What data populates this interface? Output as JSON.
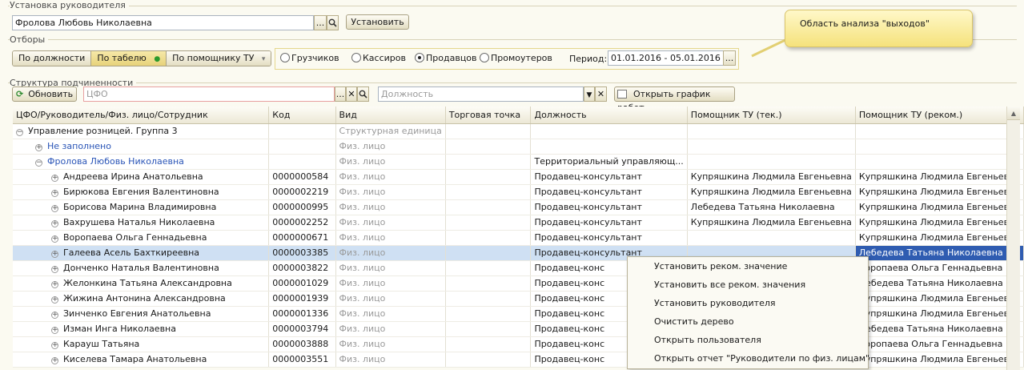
{
  "manager_group": {
    "title": "Установка руководителя",
    "manager_value": "Фролова Любовь Николаевна",
    "choose_label": "...",
    "set_label": "Установить"
  },
  "filters": {
    "title": "Отборы",
    "tabs": [
      {
        "label": "По должности"
      },
      {
        "label": "По табелю"
      },
      {
        "label": "По помощнику ТУ"
      }
    ],
    "active_tab": "По табелю",
    "radios": [
      {
        "label": "Грузчиков"
      },
      {
        "label": "Кассиров"
      },
      {
        "label": "Продавцов"
      },
      {
        "label": "Промоутеров"
      }
    ],
    "selected_radio": "Продавцов",
    "period_label": "Период:",
    "period_value": "01.01.2016 - 05.01.2016",
    "period_choose": "..."
  },
  "callout": {
    "text": "Область анализа \"выходов\""
  },
  "structure": {
    "title": "Структура подчиненности",
    "refresh_label": "Обновить",
    "cfo_placeholder": "ЦФО",
    "position_placeholder": "Должность",
    "open_schedule_label": "Открыть график работ"
  },
  "table": {
    "headers": [
      "ЦФО/Руководитель/Физ. лицо/Сотрудник",
      "Код",
      "Вид",
      "Торговая точка",
      "Должность",
      "Помощник ТУ (тек.)",
      "Помощник ТУ (реком.)"
    ],
    "rows": [
      {
        "name": "Управление розницей. Группа 3",
        "code": "",
        "kind": "Структурная единица",
        "point": "",
        "position": "",
        "cur": "",
        "rec": ""
      },
      {
        "name": "Не заполнено",
        "code": "",
        "kind": "Физ. лицо",
        "point": "",
        "position": "",
        "cur": "",
        "rec": ""
      },
      {
        "name": "Фролова Любовь Николаевна",
        "code": "",
        "kind": "Физ. лицо",
        "point": "",
        "position": "Территориальный управляющ...",
        "cur": "",
        "rec": ""
      },
      {
        "name": "Андреева Ирина Анатольевна",
        "code": "0000000584",
        "kind": "Физ. лицо",
        "point": "",
        "position": "Продавец-консультант",
        "cur": "Купряшкина Людмила Евгеньевна",
        "rec": "Купряшкина Людмила Евгеньевна"
      },
      {
        "name": "Бирюкова Евгения Валентиновна",
        "code": "0000002219",
        "kind": "Физ. лицо",
        "point": "",
        "position": "Продавец-консультант",
        "cur": "Купряшкина Людмила Евгеньевна",
        "rec": "Купряшкина Людмила Евгеньевна"
      },
      {
        "name": "Борисова Марина Владимировна",
        "code": "0000000995",
        "kind": "Физ. лицо",
        "point": "",
        "position": "Продавец-консультант",
        "cur": "Лебедева Татьяна Николаевна",
        "rec": "Купряшкина Людмила Евгеньевна"
      },
      {
        "name": "Вахрушева Наталья Николаевна",
        "code": "0000002252",
        "kind": "Физ. лицо",
        "point": "",
        "position": "Продавец-консультант",
        "cur": "Купряшкина Людмила Евгеньевна",
        "rec": "Купряшкина Людмила Евгеньевна"
      },
      {
        "name": "Воропаева Ольга Геннадьевна",
        "code": "0000000671",
        "kind": "Физ. лицо",
        "point": "",
        "position": "Продавец-консультант",
        "cur": "",
        "rec": "Купряшкина Людмила Евгеньевна"
      },
      {
        "name": "Галеева Асель Бахткиреевна",
        "code": "0000003385",
        "kind": "Физ. лицо",
        "point": "",
        "position": "Продавец-консультант",
        "cur": "",
        "rec": "Лебедева Татьяна Николаевна"
      },
      {
        "name": "Донченко Наталья Валентиновна",
        "code": "0000003822",
        "kind": "Физ. лицо",
        "point": "",
        "position": "Продавец-конс",
        "cur": "",
        "rec": "Воропаева Ольга Геннадьевна"
      },
      {
        "name": "Желонкина Татьяна Александровна",
        "code": "0000001029",
        "kind": "Физ. лицо",
        "point": "",
        "position": "Продавец-конс",
        "cur": "",
        "rec": "Лебедева Татьяна Николаевна"
      },
      {
        "name": "Жижина Антонина Александровна",
        "code": "0000001939",
        "kind": "Физ. лицо",
        "point": "",
        "position": "Продавец-конс",
        "cur": "",
        "rec": "Купряшкина Людмила Евгеньевна"
      },
      {
        "name": "Зинченко Евгения Анатольевна",
        "code": "0000001336",
        "kind": "Физ. лицо",
        "point": "",
        "position": "Продавец-конс",
        "cur": "",
        "rec": "Купряшкина Людмила Евгеньевна"
      },
      {
        "name": "Изман Инга Николаевна",
        "code": "0000003794",
        "kind": "Физ. лицо",
        "point": "",
        "position": "Продавец-конс",
        "cur": "",
        "rec": "Лебедева Татьяна Николаевна"
      },
      {
        "name": "Карауш Татьяна",
        "code": "0000003888",
        "kind": "Физ. лицо",
        "point": "",
        "position": "Продавец-конс",
        "cur": "",
        "rec": "Воропаева Ольга Геннадьевна"
      },
      {
        "name": "Киселева Тамара Анатольевна",
        "code": "0000003551",
        "kind": "Физ. лицо",
        "point": "",
        "position": "Продавец-конс",
        "cur": "",
        "rec": "Купряшкина Людмила Евгеньевна"
      }
    ]
  },
  "context_menu": {
    "items": [
      {
        "label": "Установить реком. значение"
      },
      {
        "label": "Установить все реком. значения"
      },
      {
        "label": "Установить руководителя"
      },
      {
        "label": "Очистить дерево"
      },
      {
        "label": "Открыть пользователя"
      },
      {
        "label": "Открыть отчет \"Руководители по физ. лицам\""
      }
    ]
  }
}
